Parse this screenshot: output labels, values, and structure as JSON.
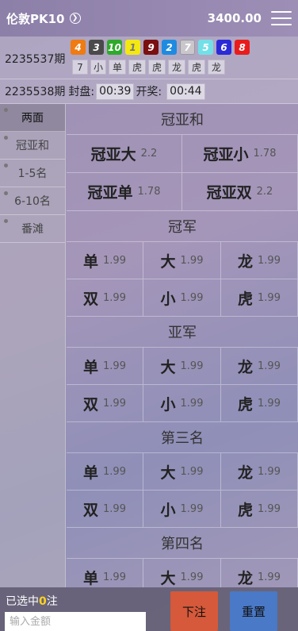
{
  "header": {
    "title": "伦敦PK10",
    "balance": "3400.00"
  },
  "last_result": {
    "period": "2235537期",
    "balls": [
      {
        "num": "4",
        "color": "#ef7b12"
      },
      {
        "num": "3",
        "color": "#4a4a4a"
      },
      {
        "num": "10",
        "color": "#2eaa2a"
      },
      {
        "num": "1",
        "color": "#f4e812"
      },
      {
        "num": "9",
        "color": "#7a1010"
      },
      {
        "num": "2",
        "color": "#1f8be0"
      },
      {
        "num": "7",
        "color": "#c9c7cc"
      },
      {
        "num": "5",
        "color": "#72e0e8"
      },
      {
        "num": "6",
        "color": "#2a2ad8"
      },
      {
        "num": "8",
        "color": "#e81c1c"
      }
    ],
    "attrs": [
      "7",
      "小",
      "单",
      "虎",
      "虎",
      "龙",
      "虎",
      "龙"
    ]
  },
  "next_issue": {
    "period": "2235538期",
    "close_label": "封盘:",
    "close_time": "00:39",
    "open_label": "开奖:",
    "open_time": "00:44"
  },
  "sidebar": {
    "items": [
      {
        "label": "两面",
        "active": true
      },
      {
        "label": "冠亚和",
        "active": false
      },
      {
        "label": "1-5名",
        "active": false
      },
      {
        "label": "6-10名",
        "active": false
      },
      {
        "label": "番滩",
        "active": false
      }
    ]
  },
  "sections": {
    "guanyahe": {
      "title": "冠亚和",
      "cells": [
        {
          "name": "冠亚大",
          "odds": "2.2"
        },
        {
          "name": "冠亚小",
          "odds": "1.78"
        },
        {
          "name": "冠亚单",
          "odds": "1.78"
        },
        {
          "name": "冠亚双",
          "odds": "2.2"
        }
      ]
    },
    "champion": {
      "title": "冠军",
      "cells": [
        {
          "name": "单",
          "odds": "1.99"
        },
        {
          "name": "大",
          "odds": "1.99"
        },
        {
          "name": "龙",
          "odds": "1.99"
        },
        {
          "name": "双",
          "odds": "1.99"
        },
        {
          "name": "小",
          "odds": "1.99"
        },
        {
          "name": "虎",
          "odds": "1.99"
        }
      ]
    },
    "runner_up": {
      "title": "亚军",
      "cells": [
        {
          "name": "单",
          "odds": "1.99"
        },
        {
          "name": "大",
          "odds": "1.99"
        },
        {
          "name": "龙",
          "odds": "1.99"
        },
        {
          "name": "双",
          "odds": "1.99"
        },
        {
          "name": "小",
          "odds": "1.99"
        },
        {
          "name": "虎",
          "odds": "1.99"
        }
      ]
    },
    "third": {
      "title": "第三名",
      "cells": [
        {
          "name": "单",
          "odds": "1.99"
        },
        {
          "name": "大",
          "odds": "1.99"
        },
        {
          "name": "龙",
          "odds": "1.99"
        },
        {
          "name": "双",
          "odds": "1.99"
        },
        {
          "name": "小",
          "odds": "1.99"
        },
        {
          "name": "虎",
          "odds": "1.99"
        }
      ]
    },
    "fourth": {
      "title": "第四名",
      "cells": [
        {
          "name": "单",
          "odds": "1.99"
        },
        {
          "name": "大",
          "odds": "1.99"
        },
        {
          "name": "龙",
          "odds": "1.99"
        }
      ]
    }
  },
  "bottom": {
    "selected_prefix": "已选中",
    "selected_count": "0",
    "selected_suffix": "注",
    "amount_placeholder": "输入金额",
    "submit_label": "下注",
    "reset_label": "重置"
  }
}
